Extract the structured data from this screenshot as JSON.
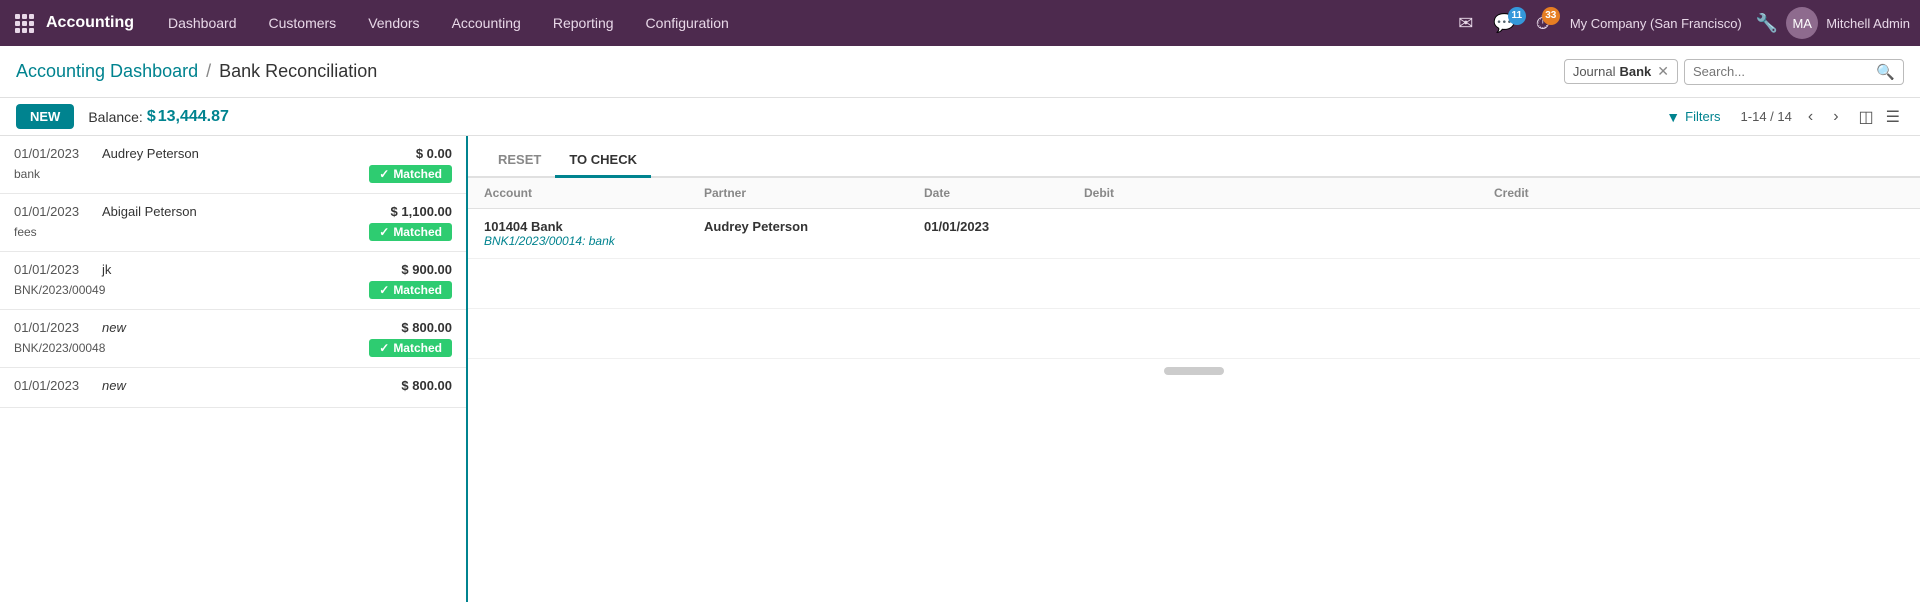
{
  "topnav": {
    "brand": "Accounting",
    "menu_items": [
      "Dashboard",
      "Customers",
      "Vendors",
      "Accounting",
      "Reporting",
      "Configuration"
    ],
    "notifications_msg_count": "11",
    "notifications_activity_count": "33",
    "company": "My Company (San Francisco)",
    "user": "Mitchell Admin"
  },
  "breadcrumb": {
    "link_label": "Accounting Dashboard",
    "separator": "/",
    "current": "Bank Reconciliation"
  },
  "search": {
    "journal_label": "Journal",
    "journal_value": "Bank",
    "placeholder": "Search..."
  },
  "toolbar": {
    "new_label": "NEW",
    "balance_label": "Balance:",
    "balance_currency": "$",
    "balance_value": "13,444.87",
    "filter_label": "Filters",
    "pagination": "1-14 / 14"
  },
  "reset_tab": "RESET",
  "tocheck_tab": "TO CHECK",
  "table_headers": {
    "account": "Account",
    "partner": "Partner",
    "date": "Date",
    "debit": "Debit",
    "credit": "Credit"
  },
  "left_rows": [
    {
      "date": "01/01/2023",
      "name": "Audrey Peterson",
      "name_italic": false,
      "amount": "$ 0.00",
      "ref": "bank",
      "matched": true
    },
    {
      "date": "01/01/2023",
      "name": "Abigail Peterson",
      "name_italic": false,
      "amount": "$ 1,100.00",
      "ref": "fees",
      "matched": true
    },
    {
      "date": "01/01/2023",
      "name": "jk",
      "name_italic": false,
      "amount": "$ 900.00",
      "ref": "BNK/2023/00049",
      "matched": true
    },
    {
      "date": "01/01/2023",
      "name": "new",
      "name_italic": true,
      "amount": "$ 800.00",
      "ref": "BNK/2023/00048",
      "matched": true
    },
    {
      "date": "01/01/2023",
      "name": "new",
      "name_italic": true,
      "amount": "$ 800.00",
      "ref": "",
      "matched": false
    }
  ],
  "right_row": {
    "account_main": "101404 Bank",
    "account_sub": "BNK1/2023/00014: bank",
    "partner": "Audrey Peterson",
    "date": "01/01/2023",
    "debit": "",
    "credit": ""
  },
  "matched_label": "Matched",
  "colors": {
    "teal": "#00838f",
    "purple_nav": "#4d2a4e",
    "green_matched": "#2ecc71"
  }
}
